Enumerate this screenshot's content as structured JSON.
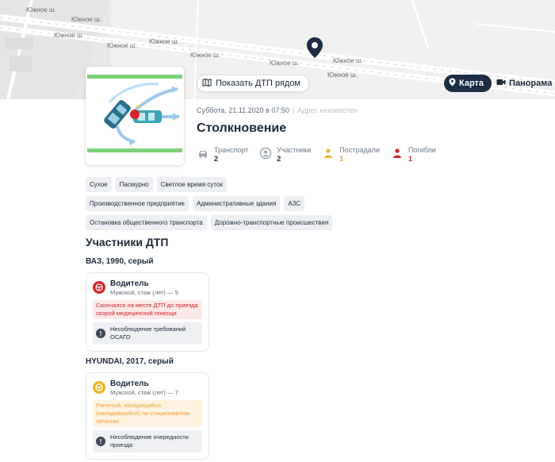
{
  "map": {
    "road_labels": [
      "Южное ш.",
      "Южное ш.",
      "Южное ш.",
      "Южное ш.",
      "Южное ш.",
      "Южное ш.",
      "Южное ш.",
      "Южное ш.",
      "Южное ш."
    ],
    "marker_icon": "location-pin-icon"
  },
  "buttons": {
    "nearby_label": "Показать ДТП рядом",
    "nearby_icon": "map-icon",
    "map_label": "Карта",
    "map_icon": "pin-icon",
    "panorama_label": "Панорама",
    "panorama_icon": "video-camera-icon"
  },
  "accident": {
    "datetime": "Суббота, 21.11.2020 в 07:50",
    "address": "Адрес неизвестен",
    "type": "Столкновение",
    "stats": [
      {
        "label": "Транспорт",
        "value": "2",
        "icon": "car-icon",
        "color": "#1c2a3a"
      },
      {
        "label": "Участники",
        "value": "2",
        "icon": "person-icon",
        "color": "#1c2a3a"
      },
      {
        "label": "Пострадали",
        "value": "1",
        "icon": "injured-icon",
        "color": "#f0a23a"
      },
      {
        "label": "Погибли",
        "value": "1",
        "icon": "dead-icon",
        "color": "#d2262b"
      }
    ],
    "tags": [
      "Сухое",
      "Пасмурно",
      "Светлое время суток",
      "Производственное предприятие",
      "Административные здания",
      "АЗС",
      "Остановка общественного транспорта",
      "Дорожно-транспортные происшествия"
    ]
  },
  "participants": {
    "title": "Участники ДТП",
    "vehicles": [
      {
        "title": "ВАЗ, 1990, серый",
        "role": "Водитель",
        "sub": "Мужской, стаж (лет) — 9",
        "status": "Скончался на месте ДТП до приезда скорой медицинской помощи",
        "violation": "Несоблюдение требований ОСАГО",
        "color": "#d2262b"
      },
      {
        "title": "HYUNDAI, 2017, серый",
        "role": "Водитель",
        "sub": "Мужской, стаж (лет) — 7",
        "status": "Раненый, находящийся (находившийся) на стационарном лечении",
        "violation": "Несоблюдение очередности проезда",
        "color": "#f0a23a"
      }
    ]
  }
}
